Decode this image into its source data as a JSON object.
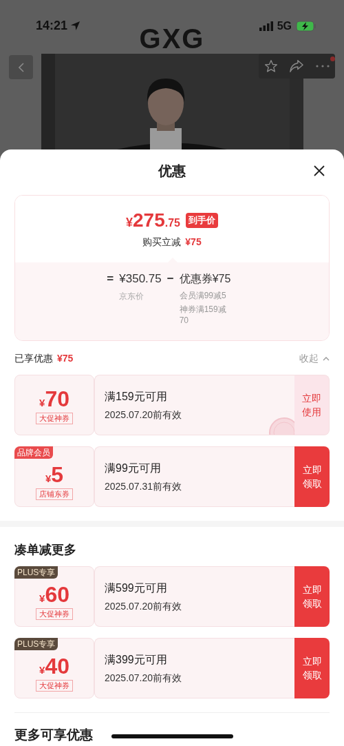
{
  "status_bar": {
    "time": "14:21",
    "network": "5G"
  },
  "header": {
    "logo": "GXG"
  },
  "sheet": {
    "title": "优惠",
    "summary": {
      "price_symbol": "¥",
      "price_int": "275",
      "price_dec": ".75",
      "price_tag": "到手价",
      "saving_label": "购买立减",
      "saving_value": "¥75",
      "equals": "=",
      "original_price": "¥350.75",
      "original_label": "京东价",
      "minus": "−",
      "coupon_total": "优惠券¥75",
      "coupon_details": [
        "会员满99减5",
        "神券满159减70"
      ]
    },
    "enjoyed": {
      "label": "已享优惠",
      "value": "¥75",
      "collapse": "收起"
    },
    "coupons": [
      {
        "symbol": "¥",
        "amount": "70",
        "tag": "大促神券",
        "condition": "满159元可用",
        "validity": "2025.07.20前有效",
        "action": "立即使用",
        "claimed": true
      },
      {
        "badge": {
          "text": "品牌会员",
          "kind": "member"
        },
        "symbol": "¥",
        "amount": "5",
        "tag": "店铺东券",
        "condition": "满99元可用",
        "validity": "2025.07.31前有效",
        "action": "立即领取",
        "claimed": false
      }
    ],
    "more_section": {
      "title": "凑单减更多",
      "coupons": [
        {
          "badge": {
            "text": "PLUS专享",
            "kind": "plus"
          },
          "symbol": "¥",
          "amount": "60",
          "tag": "大促神券",
          "condition": "满599元可用",
          "validity": "2025.07.20前有效",
          "action": "立即领取",
          "claimed": false
        },
        {
          "badge": {
            "text": "PLUS专享",
            "kind": "plus"
          },
          "symbol": "¥",
          "amount": "40",
          "tag": "大促神券",
          "condition": "满399元可用",
          "validity": "2025.07.20前有效",
          "action": "立即领取",
          "claimed": false
        }
      ]
    },
    "footer_title": "更多可享优惠"
  }
}
